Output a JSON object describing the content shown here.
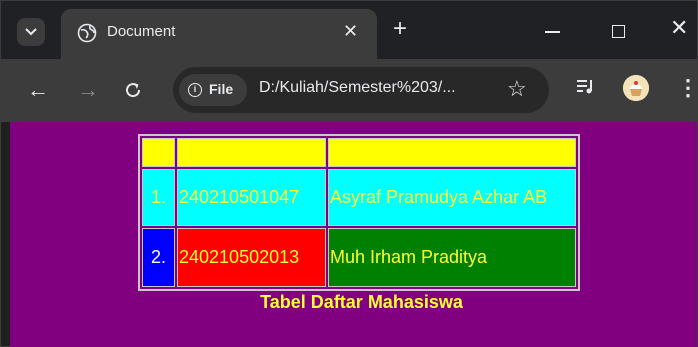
{
  "tab": {
    "title": "Document"
  },
  "toolbar": {
    "site_chip": "File",
    "url": "D:/Kuliah/Semester%203/..."
  },
  "table": {
    "header": [
      "",
      "",
      ""
    ],
    "rows": [
      {
        "no": "1.",
        "nim": "240210501047",
        "nama": "Asyraf Pramudya Azhar AB"
      },
      {
        "no": "2.",
        "nim": "240210502013",
        "nama": "Muh Irham Praditya"
      }
    ],
    "caption": "Tabel Daftar Mahasiswa"
  },
  "colors": {
    "page_bg": "#800080",
    "text": "#ffff33",
    "header_bg": "#ffff00",
    "row1_bg": "#00ffff",
    "row2_no_bg": "#0000ff",
    "row2_nim_bg": "#ff0000",
    "row2_nama_bg": "#008000"
  },
  "icons": [
    "tab-search-icon",
    "globe-icon",
    "close-icon",
    "plus-icon",
    "minimize-icon",
    "maximize-icon",
    "window-close-icon",
    "back-arrow-icon",
    "forward-arrow-icon",
    "reload-icon",
    "info-icon",
    "star-icon",
    "reading-list-icon",
    "profile-avatar",
    "menu-dots-icon"
  ]
}
